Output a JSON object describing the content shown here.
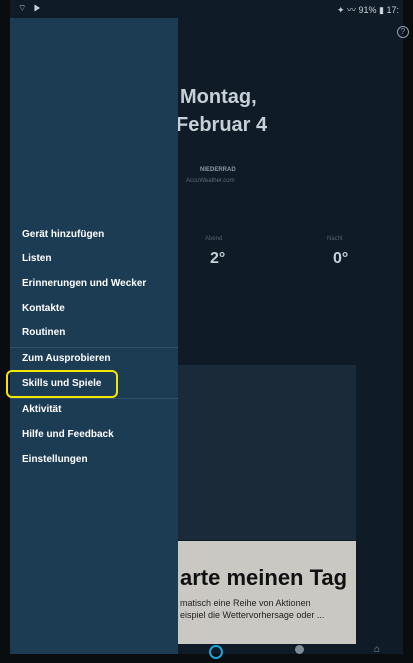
{
  "status_bar": {
    "left_icons": "⌔ ▶",
    "right_text": "✦ 〰 91% ▮ 17:"
  },
  "background_app": {
    "date_line1": "Montag,",
    "date_line2": "Februar 4",
    "location_name": "NIEDERRAD",
    "location_source": "AccuWeather.com",
    "forecast": [
      {
        "label": "Abend",
        "temp": "2°"
      },
      {
        "label": "Nacht",
        "temp": "0°"
      }
    ],
    "card_title": "arte meinen Tag",
    "card_text1": "matisch eine Reihe von Aktionen",
    "card_text2": "eispiel die Wettervorhersage oder ..."
  },
  "drawer": {
    "items": [
      {
        "label": "Gerät hinzufügen"
      },
      {
        "label": "Listen"
      },
      {
        "label": "Erinnerungen und Wecker"
      },
      {
        "label": "Kontakte"
      },
      {
        "label": "Routinen"
      },
      {
        "label": "Zum Ausprobieren"
      },
      {
        "label": "Skills und Spiele"
      },
      {
        "label": "Aktivität"
      },
      {
        "label": "Hilfe und Feedback"
      },
      {
        "label": "Einstellungen"
      }
    ]
  },
  "icons": {
    "help": "?",
    "home": "⌂"
  },
  "colors": {
    "drawer_bg": "#1c3c54",
    "highlight": "#f3e600",
    "alexa_blue": "#1fa3d6"
  }
}
